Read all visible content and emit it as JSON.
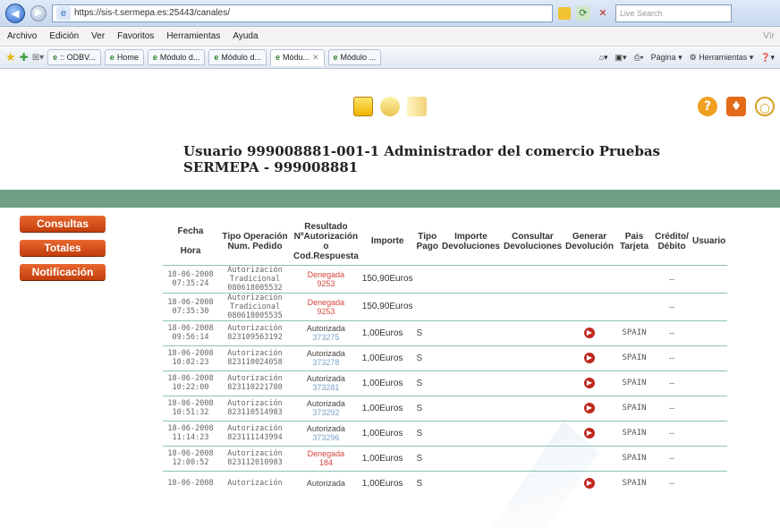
{
  "browser": {
    "url": "https://sis-t.sermepa.es:25443/canales/",
    "search_placeholder": "Live Search",
    "menu": [
      "Archivo",
      "Edición",
      "Ver",
      "Favoritos",
      "Herramientas",
      "Ayuda"
    ],
    "menu_right": "Vír",
    "tabs": [
      {
        "label": ":: ODBV..."
      },
      {
        "label": "Home"
      },
      {
        "label": "Módulo d..."
      },
      {
        "label": "Módulo d..."
      },
      {
        "label": "Módu..."
      },
      {
        "label": "Módulo ..."
      }
    ],
    "tools": {
      "pagina": "Página",
      "herramientas": "Herramientas"
    }
  },
  "header": {
    "line1": "Usuario 999008881-001-1   Administrador del comercio   Pruebas",
    "line2": "SERMEPA - 999008881"
  },
  "sidebar": {
    "items": [
      {
        "label": "Consultas"
      },
      {
        "label": "Totales"
      },
      {
        "label": "Notificación"
      }
    ]
  },
  "table": {
    "headers": {
      "fecha": "Fecha",
      "hora": "Hora",
      "tipo_op": "Tipo Operación Num. Pedido",
      "resultado": "Resultado NºAutorización o Cod.Respuesta",
      "importe": "Importe",
      "tipo_pago": "Tipo Pago",
      "importe_dev": "Importe Devoluciones",
      "consultar_dev": "Consultar Devoluciones",
      "generar_dev": "Generar Devolución",
      "pais": "Pais Tarjeta",
      "credito": "Crédito/ Débito",
      "usuario": "Usuario"
    },
    "rows": [
      {
        "fecha": "18-06-2008",
        "hora": "07:35:24",
        "tipo": "Autorización Tradicional",
        "pedido": "080618005532",
        "res": "Denegada",
        "code": "9253",
        "importe": "150,90Euros",
        "pago": "",
        "pais": "",
        "cd": "--",
        "gen": false,
        "status": "den"
      },
      {
        "fecha": "18-06-2008",
        "hora": "07:35:30",
        "tipo": "Autorización Tradicional",
        "pedido": "080618005535",
        "res": "Denegada",
        "code": "9253",
        "importe": "150,90Euros",
        "pago": "",
        "pais": "",
        "cd": "--",
        "gen": false,
        "status": "den"
      },
      {
        "fecha": "18-06-2008",
        "hora": "09:56:14",
        "tipo": "Autorización",
        "pedido": "823109563192",
        "res": "Autorizada",
        "code": "373275",
        "importe": "1,00Euros",
        "pago": "S",
        "pais": "SPAIN",
        "cd": "--",
        "gen": true,
        "status": "aut"
      },
      {
        "fecha": "18-06-2008",
        "hora": "10:02:23",
        "tipo": "Autorización",
        "pedido": "823110024058",
        "res": "Autorizada",
        "code": "373278",
        "importe": "1,00Euros",
        "pago": "S",
        "pais": "SPAIN",
        "cd": "--",
        "gen": true,
        "status": "aut"
      },
      {
        "fecha": "18-06-2008",
        "hora": "10:22:00",
        "tipo": "Autorización",
        "pedido": "823110221780",
        "res": "Autorizada",
        "code": "373281",
        "importe": "1,00Euros",
        "pago": "S",
        "pais": "SPAIN",
        "cd": "--",
        "gen": true,
        "status": "aut"
      },
      {
        "fecha": "18-06-2008",
        "hora": "10:51:32",
        "tipo": "Autorización",
        "pedido": "823110514983",
        "res": "Autorizada",
        "code": "373292",
        "importe": "1,00Euros",
        "pago": "S",
        "pais": "SPAIN",
        "cd": "--",
        "gen": true,
        "status": "aut"
      },
      {
        "fecha": "18-06-2008",
        "hora": "11:14:23",
        "tipo": "Autorización",
        "pedido": "823111143994",
        "res": "Autorizada",
        "code": "373296",
        "importe": "1,00Euros",
        "pago": "S",
        "pais": "SPAIN",
        "cd": "--",
        "gen": true,
        "status": "aut"
      },
      {
        "fecha": "18-06-2008",
        "hora": "12:00:52",
        "tipo": "Autorización",
        "pedido": "823112010983",
        "res": "Denegada",
        "code": "184",
        "importe": "1,00Euros",
        "pago": "S",
        "pais": "SPAIN",
        "cd": "--",
        "gen": false,
        "status": "den"
      },
      {
        "fecha": "18-06-2008",
        "hora": "",
        "tipo": "Autorización",
        "pedido": "",
        "res": "Autorizada",
        "code": "",
        "importe": "1,00Euros",
        "pago": "S",
        "pais": "SPAIN",
        "cd": "--",
        "gen": true,
        "status": "aut"
      }
    ]
  },
  "colors": {
    "accent": "#c33e0c",
    "band": "#6f9f86",
    "row_line": "#8bc3b3",
    "denied": "#d2463c"
  }
}
